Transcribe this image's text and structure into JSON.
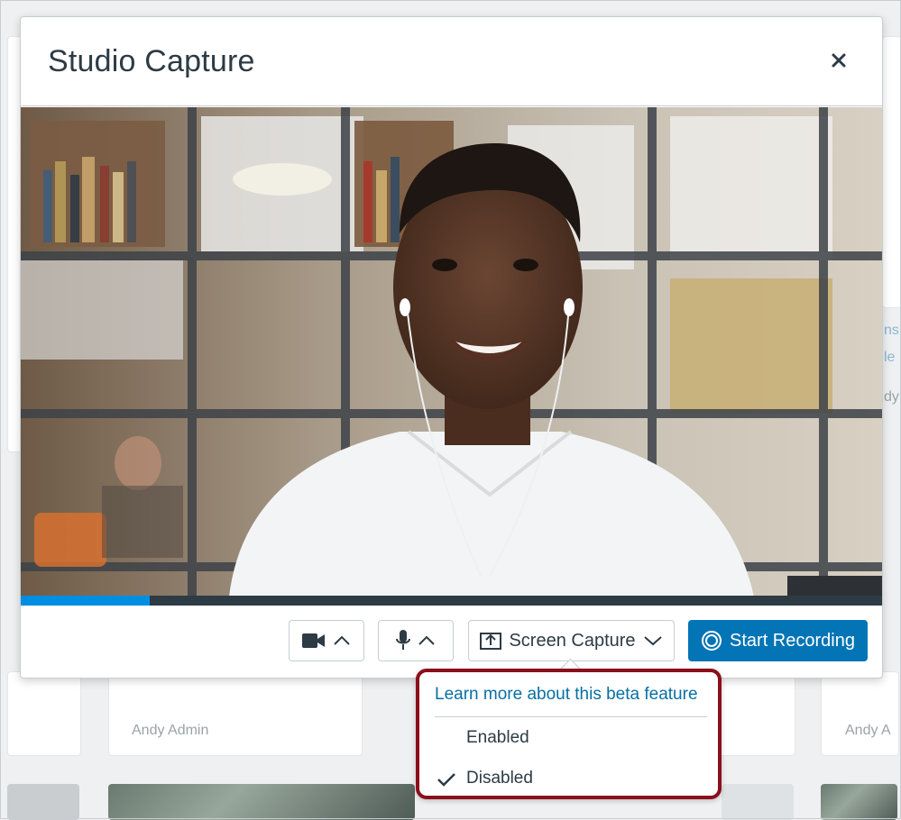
{
  "modal": {
    "title": "Studio Capture",
    "close_label": "×"
  },
  "video": {
    "progress_fraction": 0.15
  },
  "controls": {
    "camera_icon": "video-camera-icon",
    "mic_icon": "microphone-icon",
    "screen_capture_label": "Screen Capture",
    "start_recording_label": "Start Recording"
  },
  "popover": {
    "learn_more": "Learn more about this beta feature",
    "options": [
      {
        "label": "Enabled",
        "selected": false
      },
      {
        "label": "Disabled",
        "selected": true
      }
    ]
  },
  "background": {
    "author_left": "Andy Admin",
    "author_right": "Andy A",
    "side_fragments": [
      "ns",
      "le",
      "dy"
    ]
  },
  "colors": {
    "primary": "#0374b5",
    "link": "#0770a3",
    "progress": "#008ee2",
    "highlight": "#8b0f1c"
  }
}
